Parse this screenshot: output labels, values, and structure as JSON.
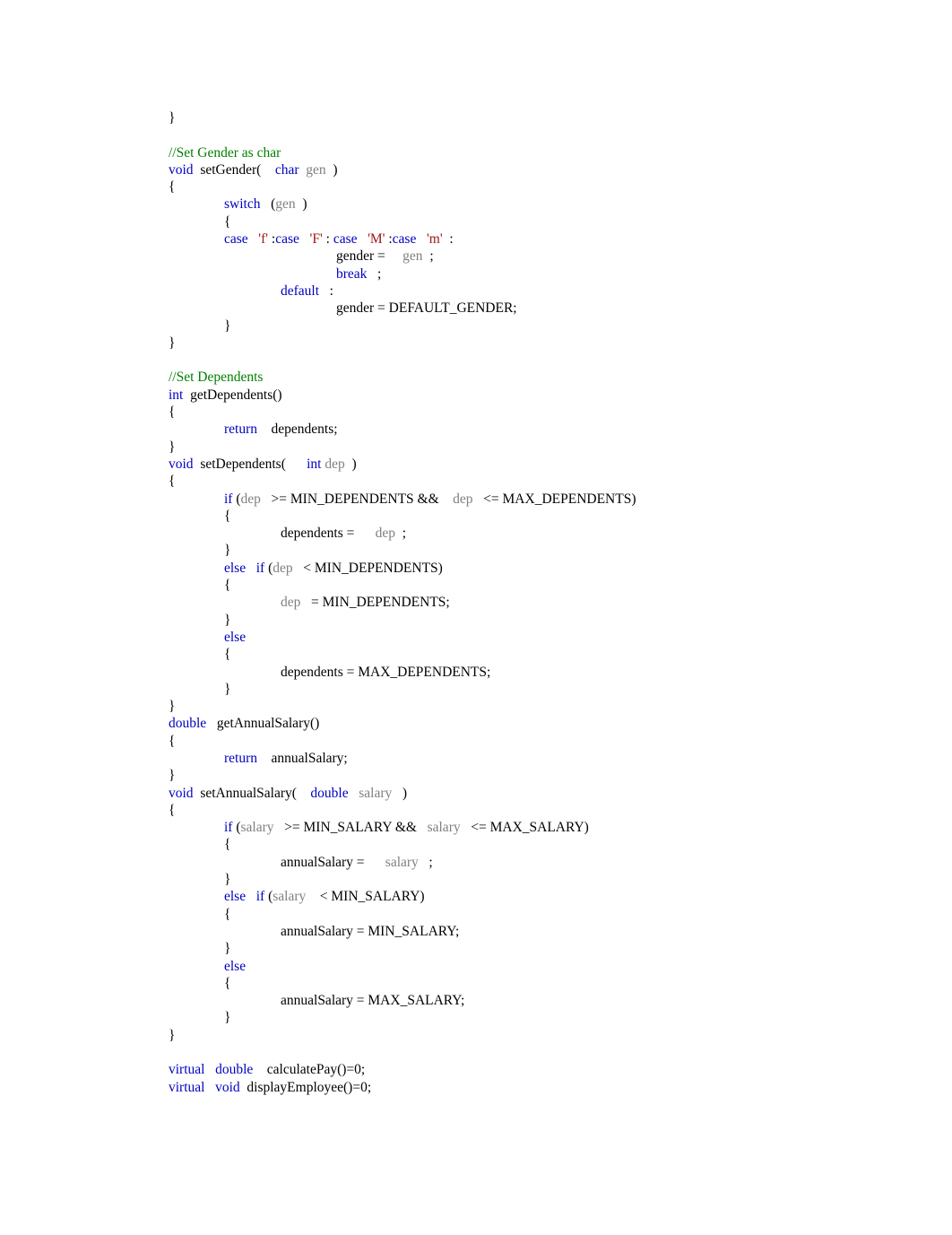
{
  "document": {
    "type": "code-listing",
    "language": "C++",
    "font": "serif",
    "colors": {
      "keyword": "#0000C0",
      "comment": "#008000",
      "char_literal": "#A31515",
      "parameter": "#808080",
      "plain": "#000000",
      "background": "#ffffff"
    }
  },
  "lines": [
    {
      "id": "l1",
      "indent": 0,
      "tokens": [
        {
          "t": "}",
          "c": "pln"
        }
      ]
    },
    {
      "id": "l2",
      "indent": 0,
      "blank": true,
      "tokens": []
    },
    {
      "id": "l3",
      "indent": 0,
      "tokens": [
        {
          "t": "//Set Gender as char",
          "c": "cmt"
        }
      ]
    },
    {
      "id": "l4",
      "indent": 0,
      "tokens": [
        {
          "t": "void",
          "c": "kw"
        },
        {
          "t": "  setGender(    ",
          "c": "pln"
        },
        {
          "t": "char",
          "c": "kw"
        },
        {
          "t": "  ",
          "c": "pln"
        },
        {
          "t": "gen",
          "c": "par"
        },
        {
          "t": "  )",
          "c": "pln"
        }
      ]
    },
    {
      "id": "l5",
      "indent": 0,
      "tokens": [
        {
          "t": "{",
          "c": "pln"
        }
      ]
    },
    {
      "id": "l6",
      "indent": 1,
      "tokens": [
        {
          "t": "switch",
          "c": "kw"
        },
        {
          "t": "   (",
          "c": "pln"
        },
        {
          "t": "gen",
          "c": "par"
        },
        {
          "t": "  )",
          "c": "pln"
        }
      ]
    },
    {
      "id": "l7",
      "indent": 1,
      "tokens": [
        {
          "t": "{",
          "c": "pln"
        }
      ]
    },
    {
      "id": "l8",
      "indent": 1,
      "tokens": [
        {
          "t": "case",
          "c": "kw"
        },
        {
          "t": "   ",
          "c": "pln"
        },
        {
          "t": "'f'",
          "c": "chr"
        },
        {
          "t": " :",
          "c": "pln"
        },
        {
          "t": "case",
          "c": "kw"
        },
        {
          "t": "   ",
          "c": "pln"
        },
        {
          "t": "'F'",
          "c": "chr"
        },
        {
          "t": " : ",
          "c": "pln"
        },
        {
          "t": "case",
          "c": "kw"
        },
        {
          "t": "   ",
          "c": "pln"
        },
        {
          "t": "'M'",
          "c": "chr"
        },
        {
          "t": " :",
          "c": "pln"
        },
        {
          "t": "case",
          "c": "kw"
        },
        {
          "t": "   ",
          "c": "pln"
        },
        {
          "t": "'m'",
          "c": "chr"
        },
        {
          "t": "  :",
          "c": "pln"
        }
      ]
    },
    {
      "id": "l9",
      "indent": 3,
      "tokens": [
        {
          "t": "gender =     ",
          "c": "pln"
        },
        {
          "t": "gen",
          "c": "par"
        },
        {
          "t": "  ;",
          "c": "pln"
        }
      ]
    },
    {
      "id": "l10",
      "indent": 3,
      "tokens": [
        {
          "t": "break",
          "c": "kw"
        },
        {
          "t": "   ;",
          "c": "pln"
        }
      ]
    },
    {
      "id": "l11",
      "indent": 2,
      "tokens": [
        {
          "t": "default",
          "c": "kw"
        },
        {
          "t": "   :",
          "c": "pln"
        }
      ]
    },
    {
      "id": "l12",
      "indent": 3,
      "tokens": [
        {
          "t": "gender = DEFAULT_GENDER;",
          "c": "pln"
        }
      ]
    },
    {
      "id": "l13",
      "indent": 1,
      "tokens": [
        {
          "t": "}",
          "c": "pln"
        }
      ]
    },
    {
      "id": "l14",
      "indent": 0,
      "tokens": [
        {
          "t": "}",
          "c": "pln"
        }
      ]
    },
    {
      "id": "l15",
      "indent": 0,
      "blank": true,
      "tokens": []
    },
    {
      "id": "l16",
      "indent": 0,
      "tokens": [
        {
          "t": "//Set Dependents",
          "c": "cmt"
        }
      ]
    },
    {
      "id": "l17",
      "indent": 0,
      "tokens": [
        {
          "t": "int",
          "c": "kw"
        },
        {
          "t": "  getDependents()",
          "c": "pln"
        }
      ]
    },
    {
      "id": "l18",
      "indent": 0,
      "tokens": [
        {
          "t": "{",
          "c": "pln"
        }
      ]
    },
    {
      "id": "l19",
      "indent": 1,
      "tokens": [
        {
          "t": "return",
          "c": "kw"
        },
        {
          "t": "    dependents;",
          "c": "pln"
        }
      ]
    },
    {
      "id": "l20",
      "indent": 0,
      "tokens": [
        {
          "t": "}",
          "c": "pln"
        }
      ]
    },
    {
      "id": "l21",
      "indent": 0,
      "tokens": [
        {
          "t": "void",
          "c": "kw"
        },
        {
          "t": "  setDependents(      ",
          "c": "pln"
        },
        {
          "t": "int",
          "c": "kw"
        },
        {
          "t": " ",
          "c": "pln"
        },
        {
          "t": "dep",
          "c": "par"
        },
        {
          "t": "  )",
          "c": "pln"
        }
      ]
    },
    {
      "id": "l22",
      "indent": 0,
      "tokens": [
        {
          "t": "{",
          "c": "pln"
        }
      ]
    },
    {
      "id": "l23",
      "indent": 1,
      "tokens": [
        {
          "t": "if",
          "c": "kw"
        },
        {
          "t": " (",
          "c": "pln"
        },
        {
          "t": "dep",
          "c": "par"
        },
        {
          "t": "   >= MIN_DEPENDENTS &&    ",
          "c": "pln"
        },
        {
          "t": "dep",
          "c": "par"
        },
        {
          "t": "   <= MAX_DEPENDENTS)",
          "c": "pln"
        }
      ]
    },
    {
      "id": "l24",
      "indent": 1,
      "tokens": [
        {
          "t": "{",
          "c": "pln"
        }
      ]
    },
    {
      "id": "l25",
      "indent": 2,
      "tokens": [
        {
          "t": "dependents =      ",
          "c": "pln"
        },
        {
          "t": "dep",
          "c": "par"
        },
        {
          "t": "  ;",
          "c": "pln"
        }
      ]
    },
    {
      "id": "l26",
      "indent": 1,
      "tokens": [
        {
          "t": "}",
          "c": "pln"
        }
      ]
    },
    {
      "id": "l27",
      "indent": 1,
      "tokens": [
        {
          "t": "else",
          "c": "kw"
        },
        {
          "t": "   ",
          "c": "pln"
        },
        {
          "t": "if",
          "c": "kw"
        },
        {
          "t": " (",
          "c": "pln"
        },
        {
          "t": "dep",
          "c": "par"
        },
        {
          "t": "   < MIN_DEPENDENTS)",
          "c": "pln"
        }
      ]
    },
    {
      "id": "l28",
      "indent": 1,
      "tokens": [
        {
          "t": "{",
          "c": "pln"
        }
      ]
    },
    {
      "id": "l29",
      "indent": 2,
      "tokens": [
        {
          "t": "dep",
          "c": "par"
        },
        {
          "t": "   = MIN_DEPENDENTS;",
          "c": "pln"
        }
      ]
    },
    {
      "id": "l30",
      "indent": 1,
      "tokens": [
        {
          "t": "}",
          "c": "pln"
        }
      ]
    },
    {
      "id": "l31",
      "indent": 1,
      "tokens": [
        {
          "t": "else",
          "c": "kw"
        }
      ]
    },
    {
      "id": "l32",
      "indent": 1,
      "tokens": [
        {
          "t": "{",
          "c": "pln"
        }
      ]
    },
    {
      "id": "l33",
      "indent": 2,
      "tokens": [
        {
          "t": "dependents = MAX_DEPENDENTS;",
          "c": "pln"
        }
      ]
    },
    {
      "id": "l34",
      "indent": 1,
      "tokens": [
        {
          "t": "}",
          "c": "pln"
        }
      ]
    },
    {
      "id": "l35",
      "indent": 0,
      "tokens": [
        {
          "t": "}",
          "c": "pln"
        }
      ]
    },
    {
      "id": "l36",
      "indent": 0,
      "tokens": [
        {
          "t": "double",
          "c": "kw"
        },
        {
          "t": "   getAnnualSalary()",
          "c": "pln"
        }
      ]
    },
    {
      "id": "l37",
      "indent": 0,
      "tokens": [
        {
          "t": "{",
          "c": "pln"
        }
      ]
    },
    {
      "id": "l38",
      "indent": 1,
      "tokens": [
        {
          "t": "return",
          "c": "kw"
        },
        {
          "t": "    annualSalary;",
          "c": "pln"
        }
      ]
    },
    {
      "id": "l39",
      "indent": 0,
      "tokens": [
        {
          "t": "}",
          "c": "pln"
        }
      ]
    },
    {
      "id": "l40",
      "indent": 0,
      "tokens": [
        {
          "t": "void",
          "c": "kw"
        },
        {
          "t": "  setAnnualSalary(    ",
          "c": "pln"
        },
        {
          "t": "double",
          "c": "kw"
        },
        {
          "t": "   ",
          "c": "pln"
        },
        {
          "t": "salary",
          "c": "par"
        },
        {
          "t": "   )",
          "c": "pln"
        }
      ]
    },
    {
      "id": "l41",
      "indent": 0,
      "tokens": [
        {
          "t": "{",
          "c": "pln"
        }
      ]
    },
    {
      "id": "l42",
      "indent": 1,
      "tokens": [
        {
          "t": "if",
          "c": "kw"
        },
        {
          "t": " (",
          "c": "pln"
        },
        {
          "t": "salary",
          "c": "par"
        },
        {
          "t": "   >= MIN_SALARY &&   ",
          "c": "pln"
        },
        {
          "t": "salary",
          "c": "par"
        },
        {
          "t": "   <= MAX_SALARY)",
          "c": "pln"
        }
      ]
    },
    {
      "id": "l43",
      "indent": 1,
      "tokens": [
        {
          "t": "{",
          "c": "pln"
        }
      ]
    },
    {
      "id": "l44",
      "indent": 2,
      "tokens": [
        {
          "t": "annualSalary =      ",
          "c": "pln"
        },
        {
          "t": "salary",
          "c": "par"
        },
        {
          "t": "   ;",
          "c": "pln"
        }
      ]
    },
    {
      "id": "l45",
      "indent": 1,
      "tokens": [
        {
          "t": "}",
          "c": "pln"
        }
      ]
    },
    {
      "id": "l46",
      "indent": 1,
      "tokens": [
        {
          "t": "else",
          "c": "kw"
        },
        {
          "t": "   ",
          "c": "pln"
        },
        {
          "t": "if",
          "c": "kw"
        },
        {
          "t": " (",
          "c": "pln"
        },
        {
          "t": "salary",
          "c": "par"
        },
        {
          "t": "    < MIN_SALARY)",
          "c": "pln"
        }
      ]
    },
    {
      "id": "l47",
      "indent": 1,
      "tokens": [
        {
          "t": "{",
          "c": "pln"
        }
      ]
    },
    {
      "id": "l48",
      "indent": 2,
      "tokens": [
        {
          "t": "annualSalary = MIN_SALARY;",
          "c": "pln"
        }
      ]
    },
    {
      "id": "l49",
      "indent": 1,
      "tokens": [
        {
          "t": "}",
          "c": "pln"
        }
      ]
    },
    {
      "id": "l50",
      "indent": 1,
      "tokens": [
        {
          "t": "else",
          "c": "kw"
        }
      ]
    },
    {
      "id": "l51",
      "indent": 1,
      "tokens": [
        {
          "t": "{",
          "c": "pln"
        }
      ]
    },
    {
      "id": "l52",
      "indent": 2,
      "tokens": [
        {
          "t": "annualSalary = MAX_SALARY;",
          "c": "pln"
        }
      ]
    },
    {
      "id": "l53",
      "indent": 1,
      "tokens": [
        {
          "t": "}",
          "c": "pln"
        }
      ]
    },
    {
      "id": "l54",
      "indent": 0,
      "tokens": [
        {
          "t": "}",
          "c": "pln"
        }
      ]
    },
    {
      "id": "l55",
      "indent": 0,
      "blank": true,
      "tokens": []
    },
    {
      "id": "l56",
      "indent": 0,
      "tokens": [
        {
          "t": "virtual",
          "c": "kw"
        },
        {
          "t": "   ",
          "c": "pln"
        },
        {
          "t": "double",
          "c": "kw"
        },
        {
          "t": "    calculatePay()=0;",
          "c": "pln"
        }
      ]
    },
    {
      "id": "l57",
      "indent": 0,
      "tokens": [
        {
          "t": "virtual",
          "c": "kw"
        },
        {
          "t": "   ",
          "c": "pln"
        },
        {
          "t": "void",
          "c": "kw"
        },
        {
          "t": "  displayEmployee()=0;",
          "c": "pln"
        }
      ]
    }
  ]
}
